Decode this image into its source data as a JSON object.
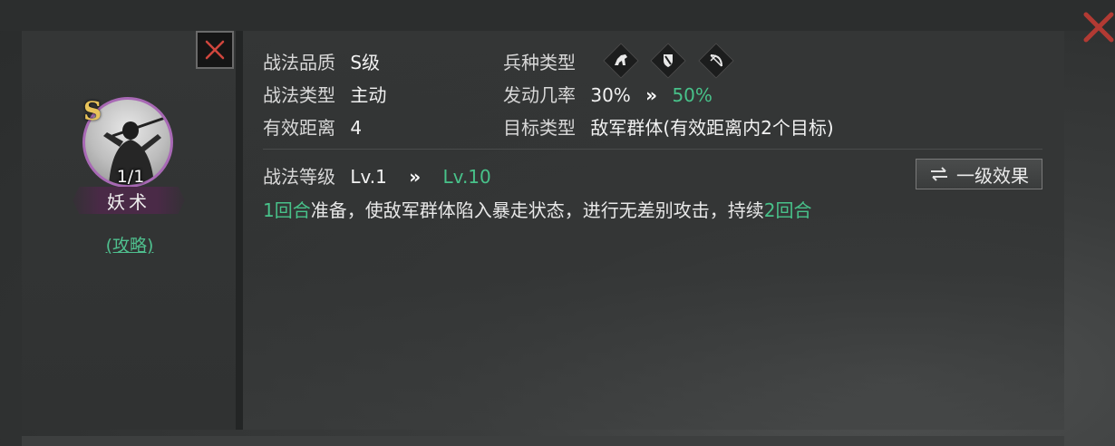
{
  "skill_card": {
    "grade": "S",
    "count": "1/1",
    "name": "妖术",
    "strategy_link": "(攻略)"
  },
  "info": {
    "quality_label": "战法品质",
    "quality_value": "S级",
    "type_label": "战法类型",
    "type_value": "主动",
    "range_label": "有效距离",
    "range_value": "4",
    "troop_label": "兵种类型",
    "troop_icons": [
      "cavalry-icon",
      "shield-icon",
      "bow-icon"
    ],
    "rate_label": "发动几率",
    "rate_from": "30%",
    "rate_arrow": "»",
    "rate_to": "50%",
    "target_label": "目标类型",
    "target_value": "敌军群体(有效距离内2个目标)"
  },
  "level": {
    "label": "战法等级",
    "from": "Lv.1",
    "arrow": "»",
    "to": "Lv.10"
  },
  "effect_button": {
    "icon": "swap-icon",
    "label": "一级效果"
  },
  "description": {
    "part1": "1回合",
    "part2": "准备，使敌军群体陷入暴走状态，进行无差别攻击，持续",
    "part3": "2回合"
  },
  "colors": {
    "accent_green": "#48c28a",
    "grade_gold": "#e8c35a",
    "avatar_ring": "#a869b5",
    "close_red": "#c9413a"
  }
}
